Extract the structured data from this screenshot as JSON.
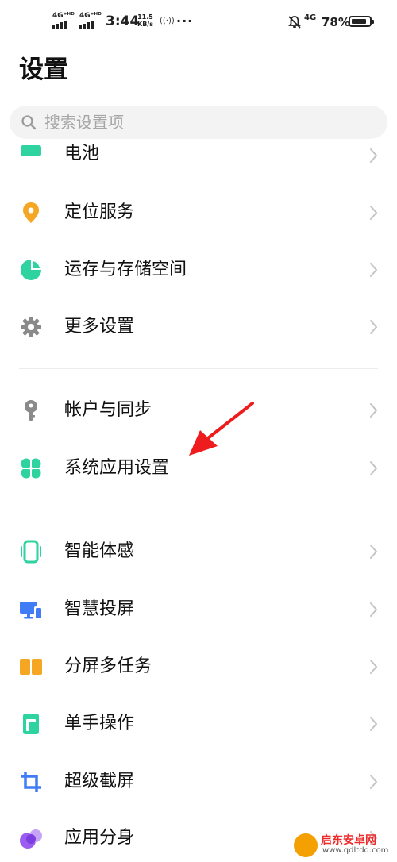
{
  "status_bar": {
    "sim1": "4G⁺ᴴᴰ",
    "sim2": "4G⁺ᴴᴰ",
    "time": "3:44",
    "speed_value": "11.5",
    "speed_unit": "KB/s",
    "hotspot": "((·))",
    "more": "···",
    "network": "4G",
    "battery_percent": "78%"
  },
  "page_title": "设置",
  "search": {
    "placeholder": "搜索设置项"
  },
  "items": [
    {
      "label": "电池",
      "icon": "battery-icon",
      "color": "#2ed3a0"
    },
    {
      "label": "定位服务",
      "icon": "location-icon",
      "color": "#f5a623"
    },
    {
      "label": "运存与存储空间",
      "icon": "storage-pie-icon",
      "color": "#2ed3a0"
    },
    {
      "label": "更多设置",
      "icon": "gear-icon",
      "color": "#8a8a8a"
    },
    {
      "label": "帐户与同步",
      "icon": "key-icon",
      "color": "#8a8a8a"
    },
    {
      "label": "系统应用设置",
      "icon": "clover-icon",
      "color": "#2ed3a0"
    },
    {
      "label": "智能体感",
      "icon": "phone-motion-icon",
      "color": "#2ed3a0"
    },
    {
      "label": "智慧投屏",
      "icon": "screen-cast-icon",
      "color": "#3f7cf5"
    },
    {
      "label": "分屏多任务",
      "icon": "split-screen-icon",
      "color": "#f5a623"
    },
    {
      "label": "单手操作",
      "icon": "one-hand-icon",
      "color": "#2ed3a0"
    },
    {
      "label": "超级截屏",
      "icon": "crop-icon",
      "color": "#3f7cf5"
    },
    {
      "label": "应用分身",
      "icon": "app-clone-icon",
      "color": "#9c5cf0"
    }
  ],
  "watermark": {
    "name": "启东安卓网",
    "url": "www.qdltdq.com"
  }
}
